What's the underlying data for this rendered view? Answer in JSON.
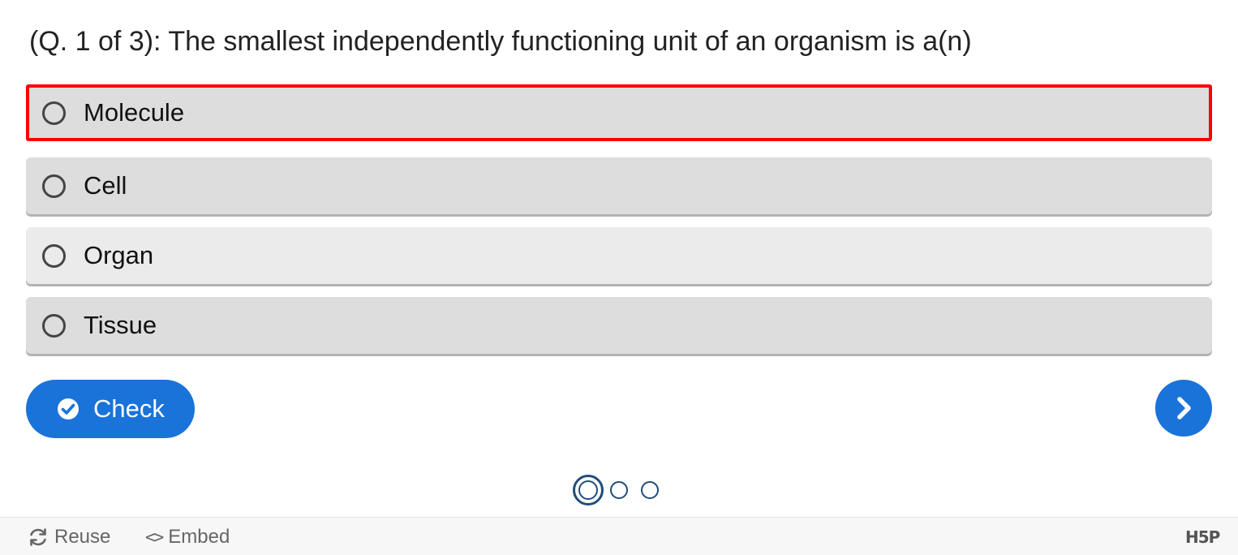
{
  "question": {
    "text": "(Q. 1 of 3): The smallest independently functioning unit of an organism is a(n)"
  },
  "answers": [
    {
      "label": "Molecule"
    },
    {
      "label": "Cell"
    },
    {
      "label": "Organ"
    },
    {
      "label": "Tissue"
    }
  ],
  "buttons": {
    "check_label": "Check",
    "check_icon": "check-circle-icon",
    "next_icon": "chevron-right-icon"
  },
  "progress": {
    "current": 1,
    "total": 3
  },
  "footer": {
    "reuse_label": "Reuse",
    "reuse_icon": "refresh-icon",
    "embed_label": "Embed",
    "embed_icon": "code-icon",
    "logo_text": "H5P"
  },
  "colors": {
    "accent": "#1a73d9",
    "focus_outline": "#ff0000",
    "dot_color": "#1f4d7a",
    "option_bg": "#dddddd",
    "option_bg_hover": "#ebebeb"
  }
}
